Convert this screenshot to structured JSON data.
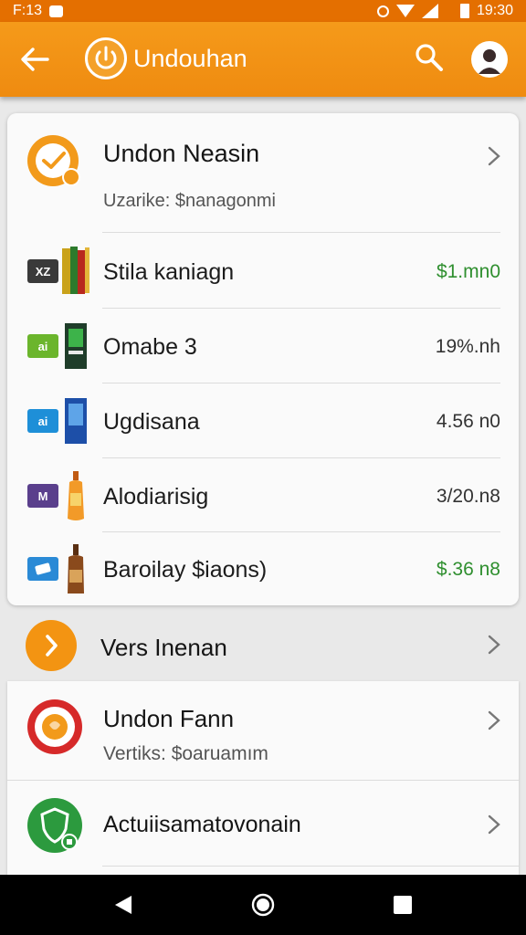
{
  "status_bar": {
    "left_text": "F:13",
    "time": "19:30"
  },
  "app_bar": {
    "title": "Undouhan"
  },
  "card": {
    "header": {
      "title": "Undon Neasin",
      "subtitle": "Uzarike: $nanagonmi"
    },
    "items": [
      {
        "badge": "XZ",
        "label": "Stila kaniagn",
        "value": "$1.mn0",
        "value_color": "#2f8f2f"
      },
      {
        "badge": "ai",
        "label": "Omabe 3",
        "value": "19%.nh",
        "value_color": "#333333"
      },
      {
        "badge": "ai",
        "label": "Ugdisana",
        "value": "4.56 n0",
        "value_color": "#333333"
      },
      {
        "badge": "M",
        "label": "Alodiarisig",
        "value": "3/20.n8",
        "value_color": "#333333"
      },
      {
        "badge": "",
        "label": "Baroilay $iaons)",
        "value": "$.36 n8",
        "value_color": "#2f8f2f"
      }
    ]
  },
  "section": {
    "title": "Vers Inenan"
  },
  "panel": {
    "fann": {
      "title": "Undon Fann",
      "subtitle": "Vertiks: $oaruamım"
    },
    "act": {
      "title": "Actuiisamatovonain"
    }
  },
  "colors": {
    "accent": "#ef8b10",
    "green": "#2f8f2f",
    "red": "#d62a2a",
    "green_icon": "#2c9a3e"
  }
}
